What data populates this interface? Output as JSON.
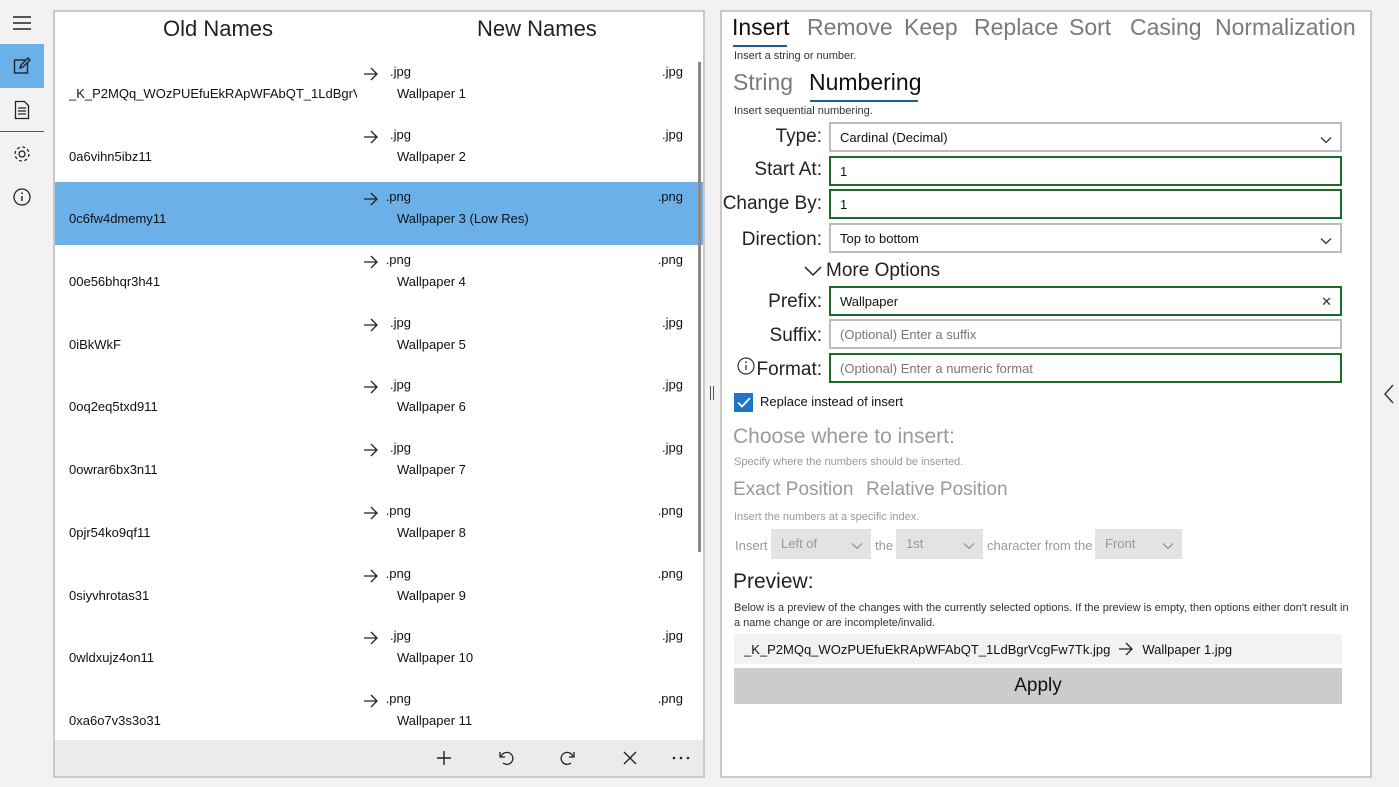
{
  "nav": {
    "items": [
      {
        "name": "hamburger-menu-icon"
      },
      {
        "name": "edit-icon"
      },
      {
        "name": "document-icon"
      },
      {
        "name": "gear-icon"
      },
      {
        "name": "info-icon"
      }
    ]
  },
  "file_list": {
    "old_header": "Old Names",
    "new_header": "New Names",
    "rows": [
      {
        "old_ext": ".jpg",
        "old_name": "_K_P2MQq_WOzPUEfuEkRApWFAbQT_1LdBgrVcgFw7Tk",
        "new_ext": ".jpg",
        "new_name": "Wallpaper 1"
      },
      {
        "old_ext": ".jpg",
        "old_name": "0a6vihn5ibz11",
        "new_ext": ".jpg",
        "new_name": "Wallpaper 2"
      },
      {
        "old_ext": ".png",
        "old_name": "0c6fw4dmemy11",
        "new_ext": ".png",
        "new_name": "Wallpaper 3 (Low Res)"
      },
      {
        "old_ext": ".png",
        "old_name": "00e56bhqr3h41",
        "new_ext": ".png",
        "new_name": "Wallpaper 4"
      },
      {
        "old_ext": ".jpg",
        "old_name": "0iBkWkF",
        "new_ext": ".jpg",
        "new_name": "Wallpaper 5"
      },
      {
        "old_ext": ".jpg",
        "old_name": "0oq2eq5txd911",
        "new_ext": ".jpg",
        "new_name": "Wallpaper 6"
      },
      {
        "old_ext": ".jpg",
        "old_name": "0owrar6bx3n11",
        "new_ext": ".jpg",
        "new_name": "Wallpaper 7"
      },
      {
        "old_ext": ".png",
        "old_name": "0pjr54ko9qf11",
        "new_ext": ".png",
        "new_name": "Wallpaper 8"
      },
      {
        "old_ext": ".png",
        "old_name": "0siyvhrotas31",
        "new_ext": ".png",
        "new_name": "Wallpaper 9"
      },
      {
        "old_ext": ".jpg",
        "old_name": "0wldxujz4on11",
        "new_ext": ".jpg",
        "new_name": "Wallpaper 10"
      },
      {
        "old_ext": ".png",
        "old_name": "0xa6o7v3s3o31",
        "new_ext": ".png",
        "new_name": "Wallpaper 11"
      }
    ],
    "selected_index": 2,
    "toolbar": [
      {
        "name": "add-icon"
      },
      {
        "name": "undo-icon"
      },
      {
        "name": "redo-icon"
      },
      {
        "name": "clear-icon"
      },
      {
        "name": "more-icon"
      }
    ]
  },
  "panel": {
    "tabs": [
      "Insert",
      "Remove",
      "Keep",
      "Replace",
      "Sort",
      "Casing",
      "Normalization"
    ],
    "active_tab": "Insert",
    "tab_desc": "Insert a string or number.",
    "subtabs": [
      "String",
      "Numbering"
    ],
    "active_subtab": "Numbering",
    "subtab_desc": "Insert sequential numbering.",
    "type_label": "Type:",
    "type_value": "Cardinal (Decimal)",
    "start_label": "Start At:",
    "start_value": "1",
    "change_label": "Change By:",
    "change_value": "1",
    "direction_label": "Direction:",
    "direction_value": "Top to bottom",
    "more_options": "More Options",
    "prefix_label": "Prefix:",
    "prefix_value": "Wallpaper",
    "suffix_label": "Suffix:",
    "suffix_placeholder": "(Optional) Enter a suffix",
    "format_label": "Format:",
    "format_placeholder": "(Optional) Enter a numeric format",
    "replace_checkbox_label": "Replace instead of insert",
    "replace_checked": true,
    "where_heading": "Choose where to insert:",
    "where_desc": "Specify where the numbers should be inserted.",
    "position_tabs": [
      "Exact Position",
      "Relative Position"
    ],
    "position_desc": "Insert the numbers at a specific index.",
    "insert_word": "Insert",
    "side_value": "Left of",
    "the_word": "the",
    "index_value": "1st",
    "char_from_word": "character from the",
    "origin_value": "Front",
    "preview_heading": "Preview:",
    "preview_desc": "Below is a preview of the changes with the currently selected options. If the preview is empty, then options either don't result in a name change or are incomplete/invalid.",
    "preview_old": "_K_P2MQq_WOzPUEfuEkRApWFAbQT_1LdBgrVcgFw7Tk.jpg",
    "preview_new": "Wallpaper 1.jpg",
    "apply_label": "Apply"
  },
  "colors": {
    "selection": "#6cb0ea",
    "accent": "#1e74c6",
    "valid_border": "#1b6b2a"
  }
}
